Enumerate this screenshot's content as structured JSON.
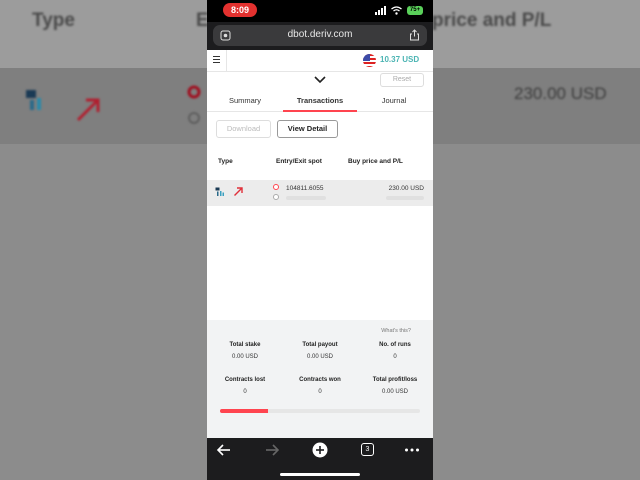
{
  "background": {
    "type_header": "Type",
    "e_header": "E",
    "price_header": "price and P/L",
    "amount": "230.00 USD"
  },
  "status_bar": {
    "time": "8:09",
    "battery": "75+"
  },
  "browser": {
    "url": "dbot.deriv.com"
  },
  "header": {
    "balance": "10.37 USD",
    "reset_label": "Reset"
  },
  "tabs": [
    {
      "label": "Summary"
    },
    {
      "label": "Transactions"
    },
    {
      "label": "Journal"
    }
  ],
  "toolbar": {
    "download_label": "Download",
    "view_detail_label": "View Detail"
  },
  "table": {
    "columns": [
      "Type",
      "Entry/Exit spot",
      "Buy price and P/L"
    ],
    "rows": [
      {
        "entry_spot": "104811.6055",
        "buy_price": "230.00 USD"
      }
    ]
  },
  "stats": {
    "whats_this": "What's this?",
    "items": [
      {
        "label": "Total stake",
        "value": "0.00 USD"
      },
      {
        "label": "Total payout",
        "value": "0.00 USD"
      },
      {
        "label": "No. of runs",
        "value": "0"
      },
      {
        "label": "Contracts lost",
        "value": "0"
      },
      {
        "label": "Contracts won",
        "value": "0"
      },
      {
        "label": "Total profit/loss",
        "value": "0.00 USD"
      }
    ],
    "progress_fraction": 0.24
  },
  "browser_nav": {
    "tab_count": "3"
  },
  "colors": {
    "accent": "#ff444f",
    "balance": "#4bb4b3"
  }
}
